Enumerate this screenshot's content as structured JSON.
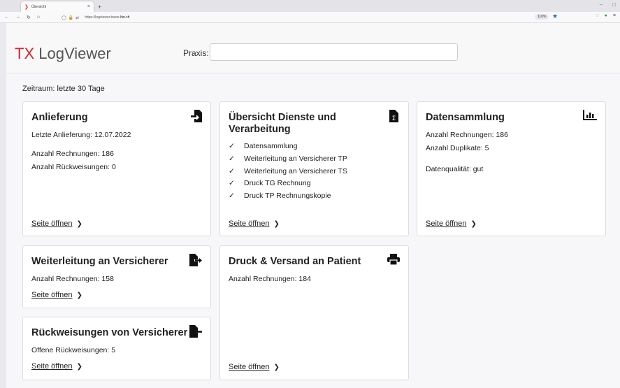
{
  "browser": {
    "tab_title": "Übersicht",
    "tab_close": "×",
    "new_tab": "+",
    "url_prefix": "https://logviewer.trustx.",
    "url_host": "hin.ch",
    "zoom": "110%",
    "window_controls": [
      "–",
      "□"
    ]
  },
  "header": {
    "logo_tx": "TX",
    "logo_rest": " LogViewer",
    "praxis_label": "Praxis:",
    "praxis_value": ""
  },
  "zeitraum": "Zeitraum: letzte 30 Tage",
  "open_link": "Seite öffnen",
  "cards": {
    "anlieferung": {
      "title": "Anlieferung",
      "last": "Letzte Anlieferung: 12.07.2022",
      "rechnungen": "Anzahl Rechnungen: 186",
      "rueckweisungen": "Anzahl Rückweisungen: 0",
      "icon": "file-import-icon"
    },
    "dienste": {
      "title_line1": "Übersicht Dienste und",
      "title_line2": "Verarbeitung",
      "checkmark": "✓",
      "items": [
        "Datensammlung",
        "Weiterleitung an Versicherer TP",
        "Weiterleitung an Versicherer TS",
        "Druck TG Rechnung",
        "Druck TP Rechnungskopie"
      ],
      "icon": "file-invoice-icon"
    },
    "datensammlung": {
      "title": "Datensammlung",
      "rechnungen": "Anzahl Rechnungen: 186",
      "duplikate": "Anzahl Duplikate: 5",
      "qualitaet": "Datenqualität: gut",
      "icon": "bar-chart-icon"
    },
    "weiterleitung": {
      "title": "Weiterleitung an Versicherer",
      "rechnungen": "Anzahl Rechnungen: 158",
      "icon": "file-export-icon"
    },
    "druck": {
      "title": "Druck & Versand an Patient",
      "rechnungen": "Anzahl Rechnungen: 184",
      "icon": "printer-icon"
    },
    "rueckweisungen": {
      "title": "Rückweisungen von Versicherer",
      "offene": "Offene Rückweisungen: 5",
      "icon": "file-return-icon"
    }
  }
}
